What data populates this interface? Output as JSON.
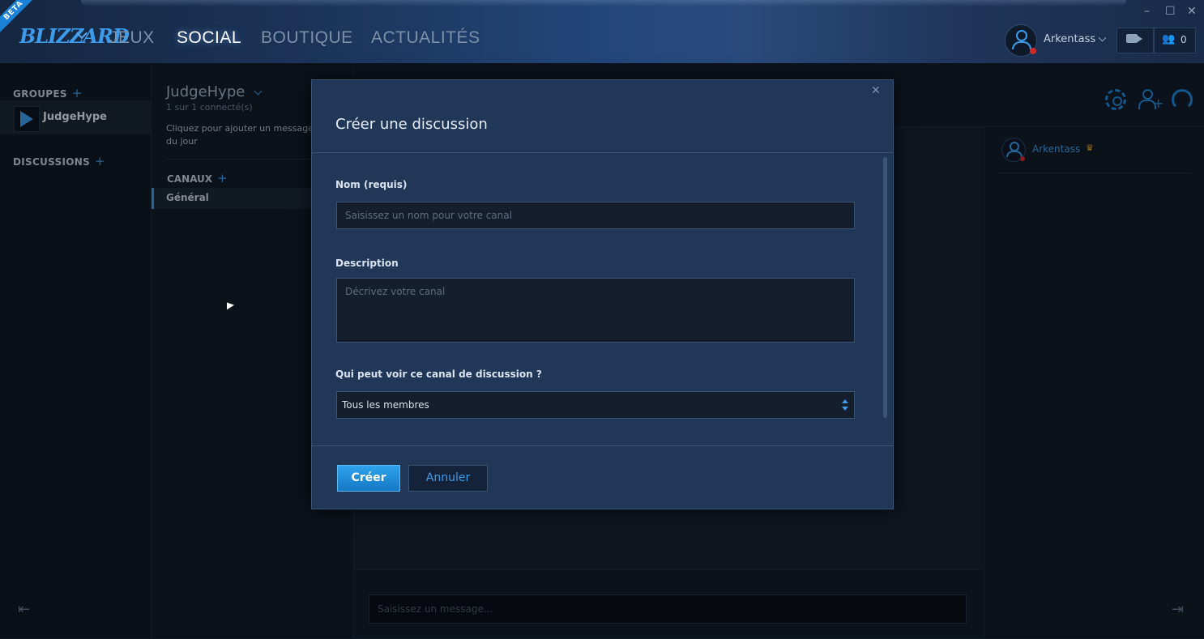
{
  "topbar": {
    "badge": "BETA",
    "logo": "BLIZZARD",
    "nav": [
      {
        "label": "JEUX",
        "active": false
      },
      {
        "label": "SOCIAL",
        "active": true
      },
      {
        "label": "BOUTIQUE",
        "active": false
      },
      {
        "label": "ACTUALITÉS",
        "active": false
      }
    ],
    "window_controls": {
      "minimize": "–",
      "maximize": "☐",
      "close": "✕"
    },
    "username": "Arkentass",
    "friends_count": "0"
  },
  "sidebar": {
    "groups_header": "GROUPES",
    "add_symbol": "+",
    "groups": [
      {
        "name": "JudgeHype"
      }
    ],
    "discussions_header": "DISCUSSIONS",
    "collapse_icon": "⇤"
  },
  "channel_panel": {
    "group_title": "JudgeHype",
    "online_status": "1 sur 1 connecté(s)",
    "message_prompt": "Cliquez pour ajouter un message du jour",
    "channels_header": "CANAUX",
    "channels": [
      {
        "name": "Général",
        "active": true
      }
    ]
  },
  "main": {
    "message_placeholder": "Saisissez un message...",
    "members": [
      {
        "name": "Arkentass",
        "crown": "♛"
      }
    ],
    "collapse_icon": "⇥"
  },
  "modal": {
    "title": "Créer une discussion",
    "close_symbol": "✕",
    "name_label": "Nom (requis)",
    "name_placeholder": "Saisissez un nom pour votre canal",
    "description_label": "Description",
    "description_placeholder": "Décrivez votre canal",
    "visibility_label": "Qui peut voir ce canal de discussion ?",
    "visibility_value": "Tous les membres",
    "create_button": "Créer",
    "cancel_button": "Annuler"
  },
  "colors": {
    "accent": "#3d9bea",
    "button_primary": "#1e86d6",
    "status_offline": "#d12a2a",
    "crown": "#e0a72a"
  }
}
